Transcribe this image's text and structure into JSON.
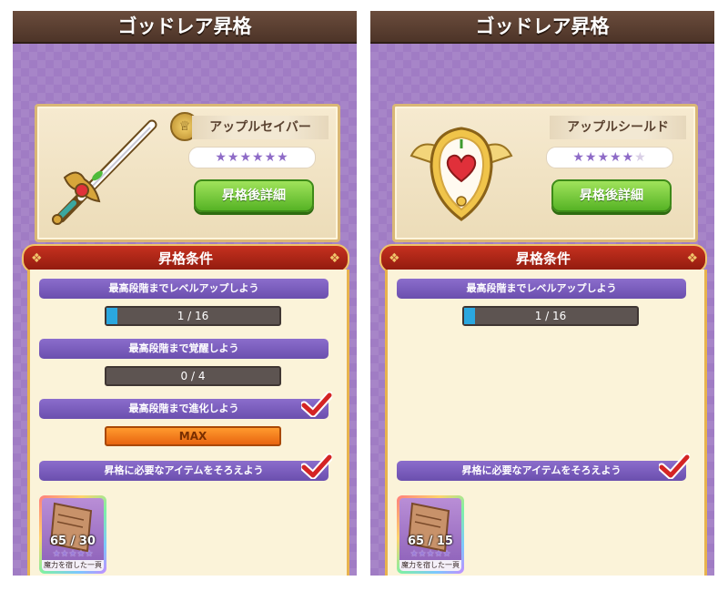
{
  "colors": {
    "title_bar": "#4d3428",
    "panel_bg": "#a07cc4",
    "condition_header": "#b12516",
    "condition_title": "#6b4fae",
    "progress_fill": "#2aa7df",
    "max_bar": "#ff8a20",
    "detail_button": "#56b325",
    "check_mark": "#d42424"
  },
  "panels": [
    {
      "title": "ゴッドレア昇格",
      "item": {
        "name": "アップルセイバー",
        "icon": "sword-icon",
        "rank_emblem": "crown-emblem-icon",
        "stars": {
          "filled": 6,
          "total": 6
        }
      },
      "detail_button": "昇格後詳細",
      "conditions_header": "昇格条件",
      "conditions": [
        {
          "title": "最高段階までレベルアップしよう",
          "progress_text": "1 / 16",
          "progress": 0.0625,
          "completed": false
        },
        {
          "title": "最高段階まで覚醒しよう",
          "progress_text": "0 / 4",
          "progress": 0,
          "completed": false
        },
        {
          "title": "最高段階まで進化しよう",
          "progress_text": "MAX",
          "progress": 1,
          "completed": true
        },
        {
          "title": "昇格に必要なアイテムをそろえよう",
          "completed": true
        }
      ],
      "material": {
        "count": "65 / 30",
        "name": "魔力を宿した一頁",
        "icon": "magic-page-icon",
        "stars": {
          "filled": 5,
          "total": 5
        }
      }
    },
    {
      "title": "ゴッドレア昇格",
      "item": {
        "name": "アップルシールド",
        "icon": "shield-icon",
        "stars": {
          "filled": 5,
          "total": 6
        }
      },
      "detail_button": "昇格後詳細",
      "conditions_header": "昇格条件",
      "conditions": [
        {
          "title": "最高段階までレベルアップしよう",
          "progress_text": "1 / 16",
          "progress": 0.0625,
          "completed": false
        },
        {
          "title": "昇格に必要なアイテムをそろえよう",
          "completed": true
        }
      ],
      "material": {
        "count": "65 / 15",
        "name": "魔力を宿した一頁",
        "icon": "magic-page-icon",
        "stars": {
          "filled": 5,
          "total": 5
        }
      }
    }
  ]
}
